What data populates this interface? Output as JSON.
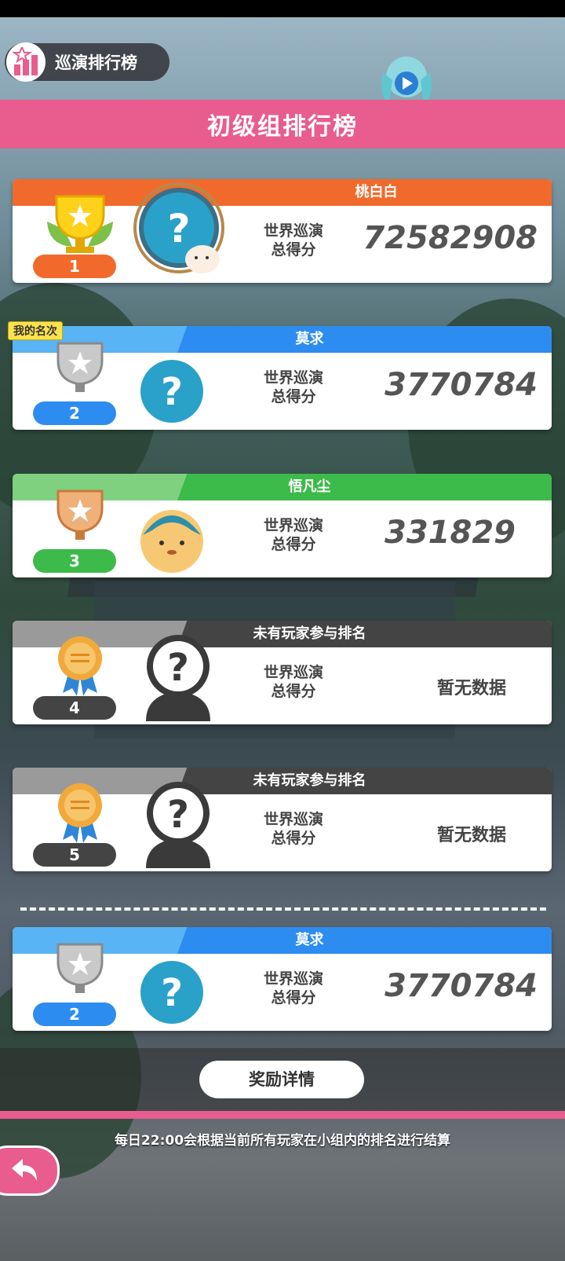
{
  "header": {
    "tab_label": "巡演排行榜",
    "banner_title": "初级组排行榜"
  },
  "my_rank_tag": "我的名次",
  "score_label_line1": "世界巡演",
  "score_label_line2": "总得分",
  "rows": [
    {
      "rank": "1",
      "name": "桃白白",
      "score": "72582908",
      "color": "#f26a2b",
      "pill_color": "#f26a2b",
      "trophy": "gold"
    },
    {
      "rank": "2",
      "name": "莫求",
      "score": "3770784",
      "color": "#2d8cf0",
      "pill_color": "#2d8cf0",
      "trophy": "silver"
    },
    {
      "rank": "3",
      "name": "悟凡尘",
      "score": "331829",
      "color": "#3cba4a",
      "pill_color": "#3cba4a",
      "trophy": "bronze"
    },
    {
      "rank": "4",
      "name": "未有玩家参与排名",
      "score": "暂无数据",
      "color": "#444444",
      "pill_color": "#444444",
      "trophy": "medal"
    },
    {
      "rank": "5",
      "name": "未有玩家参与排名",
      "score": "暂无数据",
      "color": "#444444",
      "pill_color": "#444444",
      "trophy": "medal"
    }
  ],
  "my_row": {
    "rank": "2",
    "name": "莫求",
    "score": "3770784"
  },
  "reward_button": "奖励详情",
  "notice": "每日22:00会根据当前所有玩家在小组内的排名进行结算"
}
